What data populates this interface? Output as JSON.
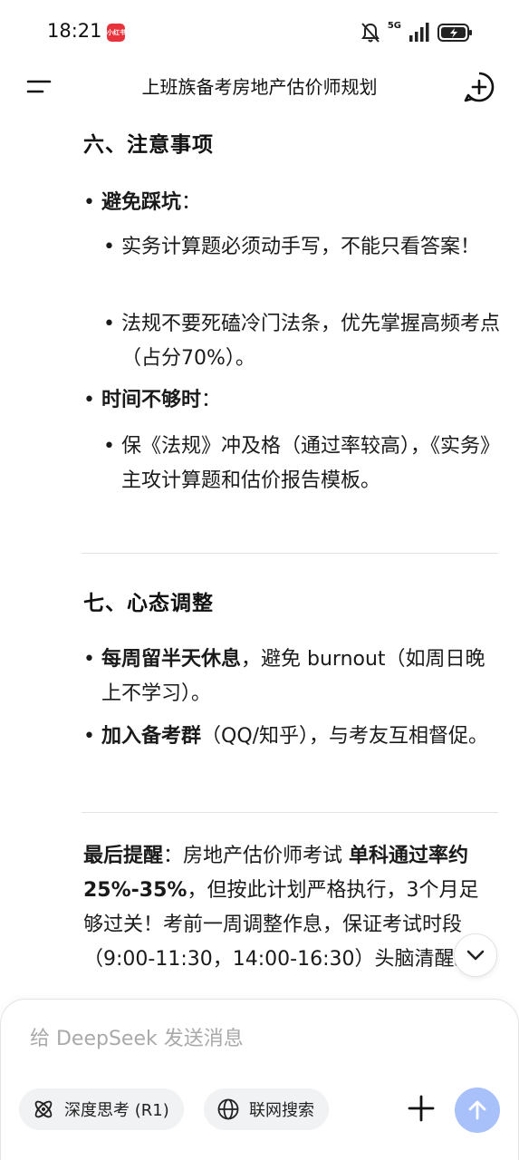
{
  "status_bar": {
    "time": "18:21",
    "app_badge": "小红书",
    "network": "5G"
  },
  "header": {
    "title": "上班族备考房地产估价师规划"
  },
  "content": {
    "section6": {
      "heading": "六、注意事项",
      "item1_label": "避免踩坑",
      "item1_colon": "：",
      "item1_sub1": "实务计算题必须动手写，不能只看答案！",
      "item1_sub2": "法规不要死磕冷门法条，优先掌握高频考点（占分70%）。",
      "item2_label": "时间不够时",
      "item2_colon": "：",
      "item2_sub1": "保《法规》冲及格（通过率较高），《实务》主攻计算题和估价报告模板。"
    },
    "section7": {
      "heading": "七、心态调整",
      "item1_bold": "每周留半天休息",
      "item1_rest": "，避免 burnout（如周日晚上不学习）。",
      "item2_bold": "加入备考群",
      "item2_rest": "（QQ/知乎），与考友互相督促。"
    },
    "final": {
      "label": "最后提醒",
      "colon": "：房地产估价师考试 ",
      "bold": "单科通过率约25%-35%",
      "rest": "，但按此计划严格执行，3个月足够过关！考前一周调整作息，保证考试时段（9:00-11:30，14:00-16:30）头脑清醒。"
    }
  },
  "composer": {
    "placeholder": "给 DeepSeek 发送消息",
    "deep_think_label": "深度思考 (R1)",
    "web_search_label": "联网搜索"
  },
  "colors": {
    "send_button": "#a9c1fb",
    "chip_bg": "#f1f2f4",
    "badge": "#e8323c"
  }
}
